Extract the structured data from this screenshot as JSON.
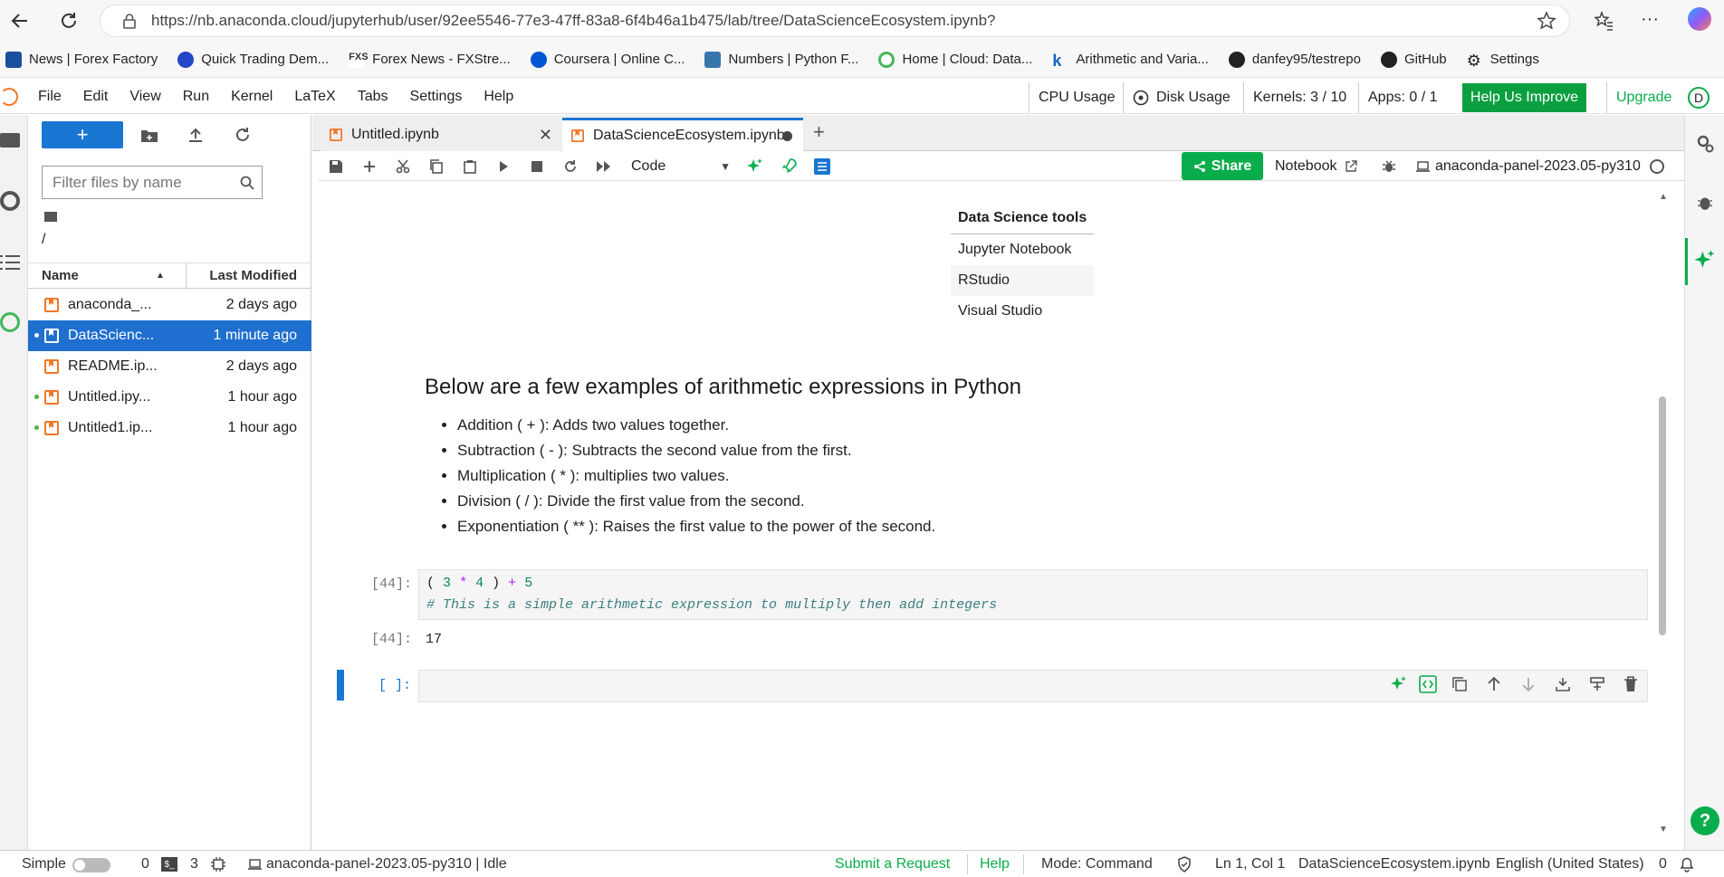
{
  "browser": {
    "url": "https://nb.anaconda.cloud/jupyterhub/user/92ee5546-77e3-47ff-83a8-6f4b46a1b475/lab/tree/DataScienceEcosystem.ipynb?",
    "bookmarks": [
      "News | Forex Factory",
      "Quick Trading Dem...",
      "Forex News - FXStre...",
      "Coursera | Online C...",
      "Numbers | Python F...",
      "Home | Cloud: Data...",
      "Arithmetic and Varia...",
      "danfey95/testrepo",
      "GitHub",
      "Settings"
    ]
  },
  "menu": [
    "File",
    "Edit",
    "View",
    "Run",
    "Kernel",
    "LaTeX",
    "Tabs",
    "Settings",
    "Help"
  ],
  "top_status": {
    "cpu": "CPU Usage",
    "disk": "Disk Usage",
    "kernels": "Kernels: 3 / 10",
    "apps": "Apps: 0 / 1",
    "help_improve": "Help Us Improve",
    "upgrade": "Upgrade",
    "avatar": "D"
  },
  "filebrowser": {
    "filter_placeholder": "Filter files by name",
    "path": "/",
    "col_name": "Name",
    "col_modified": "Last Modified",
    "files": [
      {
        "name": "anaconda_...",
        "modified": "2 days ago"
      },
      {
        "name": "DataScienc...",
        "modified": "1 minute ago"
      },
      {
        "name": "README.ip...",
        "modified": "2 days ago"
      },
      {
        "name": "Untitled.ipy...",
        "modified": "1 hour ago"
      },
      {
        "name": "Untitled1.ip...",
        "modified": "1 hour ago"
      }
    ]
  },
  "tabs": [
    {
      "label": "Untitled.ipynb"
    },
    {
      "label": "DataScienceEcosystem.ipynb"
    }
  ],
  "toolbar": {
    "cell_type": "Code",
    "share": "Share",
    "notebook": "Notebook",
    "kernel_name": "anaconda-panel-2023.05-py310"
  },
  "notebook": {
    "tools_table": {
      "header": "Data Science tools",
      "rows": [
        "Jupyter Notebook",
        "RStudio",
        "Visual Studio"
      ]
    },
    "heading": "Below are a few examples of arithmetic expressions in Python",
    "bullets": [
      "Addition ( + ): Adds two values together.",
      "Subtraction ( - ): Subtracts the second value from the first.",
      "Multiplication ( * ): multiplies two values.",
      "Division ( / ): Divide the first value from the second.",
      "Exponentiation ( ** ): Raises the first value to the power of the second."
    ],
    "cell1_prompt": "[44]:",
    "cell1_code_parts": [
      "(",
      " ",
      "3",
      " ",
      "*",
      " ",
      "4",
      " ",
      ")",
      " ",
      "+",
      " ",
      "5"
    ],
    "cell1_comment": "# This is a simple arithmetic expression to multiply then add integers",
    "out1_prompt": "[44]:",
    "out1_value": "17",
    "cell2_prompt": "[ ]:"
  },
  "statusbar": {
    "simple": "Simple",
    "zero": "0",
    "terminals": "3",
    "kernel_status": "anaconda-panel-2023.05-py310 | Idle",
    "submit_request": "Submit a Request",
    "help": "Help",
    "mode": "Mode: Command",
    "cursor": "Ln 1, Col 1",
    "file": "DataScienceEcosystem.ipynb",
    "language": "English (United States)",
    "notifications": "0"
  },
  "colors": {
    "accent": "#1976d2",
    "green": "#0aad4b",
    "selected_row": "#1f6fd0"
  }
}
